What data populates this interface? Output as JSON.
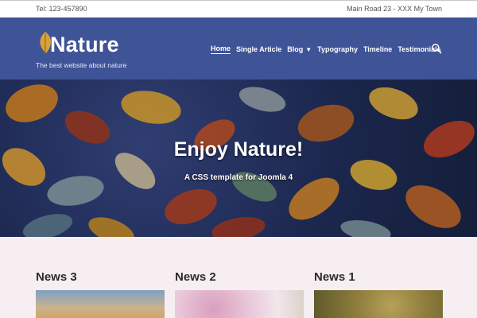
{
  "topbar": {
    "phone": "Tel: 123-457890",
    "address": "Main Road 23 - XXX My Town"
  },
  "header": {
    "logo_title": "Nature",
    "logo_subtitle": "The best website about nature",
    "nav": [
      {
        "label": "Home",
        "active": true
      },
      {
        "label": "Single Article"
      },
      {
        "label": "Blog",
        "has_dropdown": true
      },
      {
        "label": "Typography"
      },
      {
        "label": "Timeline"
      },
      {
        "label": "Testimonials"
      }
    ],
    "search_icon": "search-icon"
  },
  "hero": {
    "title": "Enjoy Nature!",
    "subtitle": "A CSS template for Joomla 4"
  },
  "news": [
    {
      "title": "News 3"
    },
    {
      "title": "News 2"
    },
    {
      "title": "News 1"
    }
  ],
  "colors": {
    "header_bg": "#3f5397",
    "page_bg": "#f7eef1",
    "logo_leaf": "#d6a23a"
  }
}
